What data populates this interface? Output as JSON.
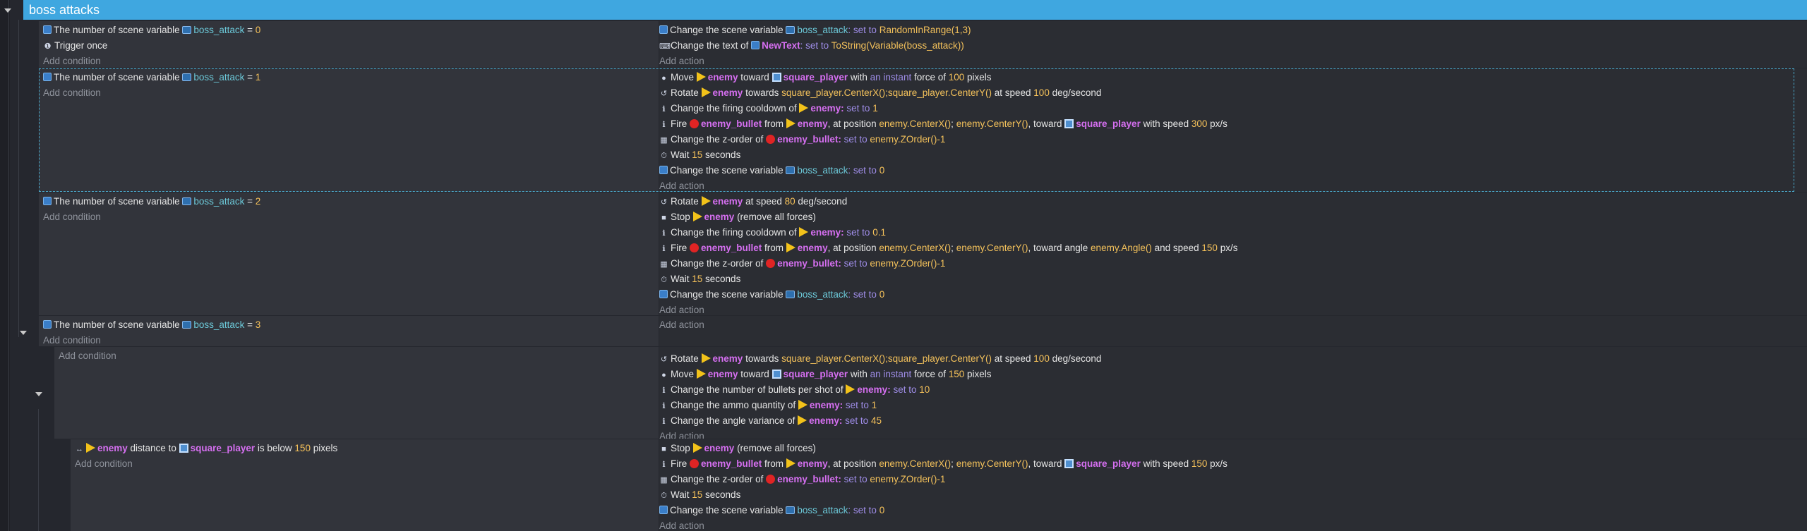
{
  "group": {
    "title": "boss attacks"
  },
  "common": {
    "add_condition": "Add condition",
    "add_action": "Add action"
  },
  "events": [
    {
      "conditions": [
        {
          "icon": "scene-variable-icon",
          "parts": [
            {
              "t": "The number of scene variable "
            },
            {
              "t": "boss_attack",
              "c": "vname",
              "icon": "variable-icon"
            },
            {
              "t": " = "
            },
            {
              "t": "0",
              "c": "num"
            }
          ]
        },
        {
          "icon": "trigger-once-icon",
          "parts": [
            {
              "t": "Trigger once"
            }
          ]
        }
      ],
      "actions": [
        {
          "icon": "scene-variable-icon",
          "parts": [
            {
              "t": "Change the scene variable "
            },
            {
              "t": "boss_attack",
              "c": "vname",
              "icon": "variable-icon"
            },
            {
              "t": ": set to ",
              "c": "kw"
            },
            {
              "t": "RandomInRange(1,3)",
              "c": "val"
            }
          ]
        },
        {
          "icon": "text-icon",
          "parts": [
            {
              "t": "Change the text of "
            },
            {
              "t": "NewText",
              "c": "obj",
              "icon": "text-object-icon"
            },
            {
              "t": ": set to ",
              "c": "kw"
            },
            {
              "t": "ToString(Variable(boss_attack))",
              "c": "val"
            }
          ]
        }
      ]
    },
    {
      "selected": true,
      "conditions": [
        {
          "icon": "scene-variable-icon",
          "parts": [
            {
              "t": "The number of scene variable "
            },
            {
              "t": "boss_attack",
              "c": "vname",
              "icon": "variable-icon"
            },
            {
              "t": " = "
            },
            {
              "t": "1",
              "c": "num"
            }
          ]
        }
      ],
      "actions": [
        {
          "icon": "force-icon",
          "parts": [
            {
              "t": "Move "
            },
            {
              "t": "enemy",
              "c": "obj",
              "icon": "sprite-icon"
            },
            {
              "t": " toward "
            },
            {
              "t": "square_player",
              "c": "obj",
              "icon": "square-icon"
            },
            {
              "t": " with "
            },
            {
              "t": "an instant",
              "c": "kw"
            },
            {
              "t": " force of "
            },
            {
              "t": "100",
              "c": "num"
            },
            {
              "t": " pixels"
            }
          ]
        },
        {
          "icon": "rotate-icon",
          "parts": [
            {
              "t": "Rotate "
            },
            {
              "t": "enemy",
              "c": "obj",
              "icon": "sprite-icon"
            },
            {
              "t": " towards "
            },
            {
              "t": "square_player.CenterX();square_player.CenterY()",
              "c": "val"
            },
            {
              "t": " at speed "
            },
            {
              "t": "100",
              "c": "num"
            },
            {
              "t": " deg/second"
            }
          ]
        },
        {
          "icon": "info-icon",
          "parts": [
            {
              "t": "Change the firing cooldown of "
            },
            {
              "t": "enemy",
              "c": "obj",
              "icon": "sprite-icon"
            },
            {
              "t": ":",
              "c": "obj"
            },
            {
              "t": " set to ",
              "c": "kw"
            },
            {
              "t": "1",
              "c": "num"
            }
          ]
        },
        {
          "icon": "info-icon",
          "parts": [
            {
              "t": "Fire "
            },
            {
              "t": "enemy_bullet",
              "c": "obj",
              "icon": "bullet-icon"
            },
            {
              "t": " from "
            },
            {
              "t": "enemy",
              "c": "obj",
              "icon": "sprite-icon"
            },
            {
              "t": ", at position "
            },
            {
              "t": "enemy.CenterX()",
              "c": "val"
            },
            {
              "t": "; "
            },
            {
              "t": "enemy.CenterY()",
              "c": "val"
            },
            {
              "t": ", toward "
            },
            {
              "t": "square_player",
              "c": "obj",
              "icon": "square-icon"
            },
            {
              "t": " with speed "
            },
            {
              "t": "300",
              "c": "num"
            },
            {
              "t": " px/s"
            }
          ]
        },
        {
          "icon": "zorder-icon",
          "parts": [
            {
              "t": "Change the z-order of "
            },
            {
              "t": "enemy_bullet",
              "c": "obj",
              "icon": "bullet-icon"
            },
            {
              "t": ":",
              "c": "obj"
            },
            {
              "t": " set to ",
              "c": "kw"
            },
            {
              "t": "enemy.ZOrder()-1",
              "c": "val"
            }
          ]
        },
        {
          "icon": "wait-icon",
          "parts": [
            {
              "t": "Wait "
            },
            {
              "t": "15",
              "c": "num"
            },
            {
              "t": " seconds"
            }
          ]
        },
        {
          "icon": "scene-variable-icon",
          "parts": [
            {
              "t": "Change the scene variable "
            },
            {
              "t": "boss_attack",
              "c": "vname",
              "icon": "variable-icon"
            },
            {
              "t": ": set to ",
              "c": "kw"
            },
            {
              "t": "0",
              "c": "num"
            }
          ]
        }
      ]
    },
    {
      "conditions": [
        {
          "icon": "scene-variable-icon",
          "parts": [
            {
              "t": "The number of scene variable "
            },
            {
              "t": "boss_attack",
              "c": "vname",
              "icon": "variable-icon"
            },
            {
              "t": " = "
            },
            {
              "t": "2",
              "c": "num"
            }
          ]
        }
      ],
      "actions": [
        {
          "icon": "rotate-icon",
          "parts": [
            {
              "t": "Rotate "
            },
            {
              "t": "enemy",
              "c": "obj",
              "icon": "sprite-icon"
            },
            {
              "t": " at speed "
            },
            {
              "t": "80",
              "c": "num"
            },
            {
              "t": " deg/second"
            }
          ]
        },
        {
          "icon": "stop-icon",
          "parts": [
            {
              "t": "Stop "
            },
            {
              "t": "enemy",
              "c": "obj",
              "icon": "sprite-icon"
            },
            {
              "t": " (remove all forces)"
            }
          ]
        },
        {
          "icon": "info-icon",
          "parts": [
            {
              "t": "Change the firing cooldown of "
            },
            {
              "t": "enemy",
              "c": "obj",
              "icon": "sprite-icon"
            },
            {
              "t": ":",
              "c": "obj"
            },
            {
              "t": " set to ",
              "c": "kw"
            },
            {
              "t": "0.1",
              "c": "num"
            }
          ]
        },
        {
          "icon": "info-icon",
          "parts": [
            {
              "t": "Fire "
            },
            {
              "t": "enemy_bullet",
              "c": "obj",
              "icon": "bullet-icon"
            },
            {
              "t": " from "
            },
            {
              "t": "enemy",
              "c": "obj",
              "icon": "sprite-icon"
            },
            {
              "t": ", at position "
            },
            {
              "t": "enemy.CenterX()",
              "c": "val"
            },
            {
              "t": "; "
            },
            {
              "t": "enemy.CenterY()",
              "c": "val"
            },
            {
              "t": ", toward angle "
            },
            {
              "t": "enemy.Angle()",
              "c": "val"
            },
            {
              "t": " and speed "
            },
            {
              "t": "150",
              "c": "num"
            },
            {
              "t": " px/s"
            }
          ]
        },
        {
          "icon": "zorder-icon",
          "parts": [
            {
              "t": "Change the z-order of "
            },
            {
              "t": "enemy_bullet",
              "c": "obj",
              "icon": "bullet-icon"
            },
            {
              "t": ":",
              "c": "obj"
            },
            {
              "t": " set to ",
              "c": "kw"
            },
            {
              "t": "enemy.ZOrder()-1",
              "c": "val"
            }
          ]
        },
        {
          "icon": "wait-icon",
          "parts": [
            {
              "t": "Wait "
            },
            {
              "t": "15",
              "c": "num"
            },
            {
              "t": " seconds"
            }
          ]
        },
        {
          "icon": "scene-variable-icon",
          "parts": [
            {
              "t": "Change the scene variable "
            },
            {
              "t": "boss_attack",
              "c": "vname",
              "icon": "variable-icon"
            },
            {
              "t": ": set to ",
              "c": "kw"
            },
            {
              "t": "0",
              "c": "num"
            }
          ]
        }
      ]
    },
    {
      "conditions": [
        {
          "icon": "scene-variable-icon",
          "parts": [
            {
              "t": "The number of scene variable "
            },
            {
              "t": "boss_attack",
              "c": "vname",
              "icon": "variable-icon"
            },
            {
              "t": " = "
            },
            {
              "t": "3",
              "c": "num"
            }
          ]
        }
      ],
      "actions": []
    },
    {
      "conditions": [],
      "actions": [
        {
          "icon": "rotate-icon",
          "parts": [
            {
              "t": "Rotate "
            },
            {
              "t": "enemy",
              "c": "obj",
              "icon": "sprite-icon"
            },
            {
              "t": " towards "
            },
            {
              "t": "square_player.CenterX();square_player.CenterY()",
              "c": "val"
            },
            {
              "t": " at speed "
            },
            {
              "t": "100",
              "c": "num"
            },
            {
              "t": " deg/second"
            }
          ]
        },
        {
          "icon": "force-icon",
          "parts": [
            {
              "t": "Move "
            },
            {
              "t": "enemy",
              "c": "obj",
              "icon": "sprite-icon"
            },
            {
              "t": " toward "
            },
            {
              "t": "square_player",
              "c": "obj",
              "icon": "square-icon"
            },
            {
              "t": " with "
            },
            {
              "t": "an instant",
              "c": "kw"
            },
            {
              "t": " force of "
            },
            {
              "t": "150",
              "c": "num"
            },
            {
              "t": " pixels"
            }
          ]
        },
        {
          "icon": "info-icon",
          "parts": [
            {
              "t": "Change the number of bullets per shot of "
            },
            {
              "t": "enemy",
              "c": "obj",
              "icon": "sprite-icon"
            },
            {
              "t": ":",
              "c": "obj"
            },
            {
              "t": " set to ",
              "c": "kw"
            },
            {
              "t": "10",
              "c": "num"
            }
          ]
        },
        {
          "icon": "info-icon",
          "parts": [
            {
              "t": "Change the ammo quantity of "
            },
            {
              "t": "enemy",
              "c": "obj",
              "icon": "sprite-icon"
            },
            {
              "t": ":",
              "c": "obj"
            },
            {
              "t": " set to ",
              "c": "kw"
            },
            {
              "t": "1",
              "c": "num"
            }
          ]
        },
        {
          "icon": "info-icon",
          "parts": [
            {
              "t": "Change the angle variance of "
            },
            {
              "t": "enemy",
              "c": "obj",
              "icon": "sprite-icon"
            },
            {
              "t": ":",
              "c": "obj"
            },
            {
              "t": " set to ",
              "c": "kw"
            },
            {
              "t": "45",
              "c": "num"
            }
          ]
        }
      ]
    },
    {
      "conditions": [
        {
          "icon": "distance-icon",
          "parts": [
            {
              "t": "enemy",
              "c": "obj",
              "icon": "sprite-icon"
            },
            {
              "t": " distance to "
            },
            {
              "t": "square_player",
              "c": "obj",
              "icon": "square-icon"
            },
            {
              "t": " is below "
            },
            {
              "t": "150",
              "c": "num"
            },
            {
              "t": " pixels"
            }
          ]
        }
      ],
      "actions": [
        {
          "icon": "stop-icon",
          "parts": [
            {
              "t": "Stop "
            },
            {
              "t": "enemy",
              "c": "obj",
              "icon": "sprite-icon"
            },
            {
              "t": " (remove all forces)"
            }
          ]
        },
        {
          "icon": "info-icon",
          "parts": [
            {
              "t": "Fire "
            },
            {
              "t": "enemy_bullet",
              "c": "obj",
              "icon": "bullet-icon"
            },
            {
              "t": " from "
            },
            {
              "t": "enemy",
              "c": "obj",
              "icon": "sprite-icon"
            },
            {
              "t": ", at position "
            },
            {
              "t": "enemy.CenterX()",
              "c": "val"
            },
            {
              "t": "; "
            },
            {
              "t": "enemy.CenterY()",
              "c": "val"
            },
            {
              "t": ", toward "
            },
            {
              "t": "square_player",
              "c": "obj",
              "icon": "square-icon"
            },
            {
              "t": " with speed "
            },
            {
              "t": "150",
              "c": "num"
            },
            {
              "t": " px/s"
            }
          ]
        },
        {
          "icon": "zorder-icon",
          "parts": [
            {
              "t": "Change the z-order of "
            },
            {
              "t": "enemy_bullet",
              "c": "obj",
              "icon": "bullet-icon"
            },
            {
              "t": ":",
              "c": "obj"
            },
            {
              "t": " set to ",
              "c": "kw"
            },
            {
              "t": "enemy.ZOrder()-1",
              "c": "val"
            }
          ]
        },
        {
          "icon": "wait-icon",
          "parts": [
            {
              "t": "Wait "
            },
            {
              "t": "15",
              "c": "num"
            },
            {
              "t": " seconds"
            }
          ]
        },
        {
          "icon": "scene-variable-icon",
          "parts": [
            {
              "t": "Change the scene variable "
            },
            {
              "t": "boss_attack",
              "c": "vname",
              "icon": "variable-icon"
            },
            {
              "t": ": set to ",
              "c": "kw"
            },
            {
              "t": "0",
              "c": "num"
            }
          ]
        }
      ]
    }
  ]
}
